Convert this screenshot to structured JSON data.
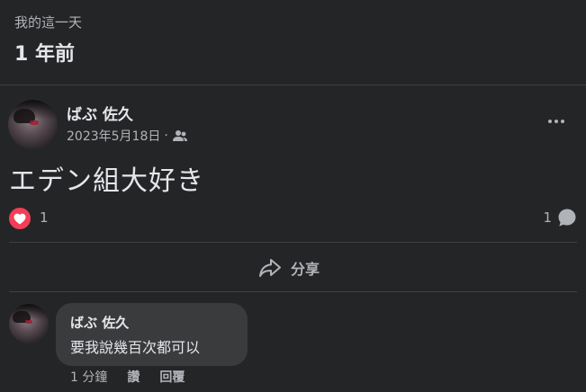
{
  "memory": {
    "label": "我的這一天",
    "time": "1 年前"
  },
  "post": {
    "author": "ばぶ 佐久",
    "date": "2023年5月18日",
    "separator": "·",
    "audience_icon": "friends-icon",
    "text": "エデン組大好き",
    "reaction_count": "1",
    "comment_count": "1",
    "share_label": "分享"
  },
  "comment": {
    "author": "ばぶ 佐久",
    "text": "要我說幾百次都可以",
    "time": "1 分鐘",
    "like_label": "讚",
    "reply_label": "回覆"
  },
  "colors": {
    "background": "#242526",
    "bubble": "#3a3b3c",
    "love": "#f33e58",
    "secondary_text": "#b0b3b8"
  }
}
